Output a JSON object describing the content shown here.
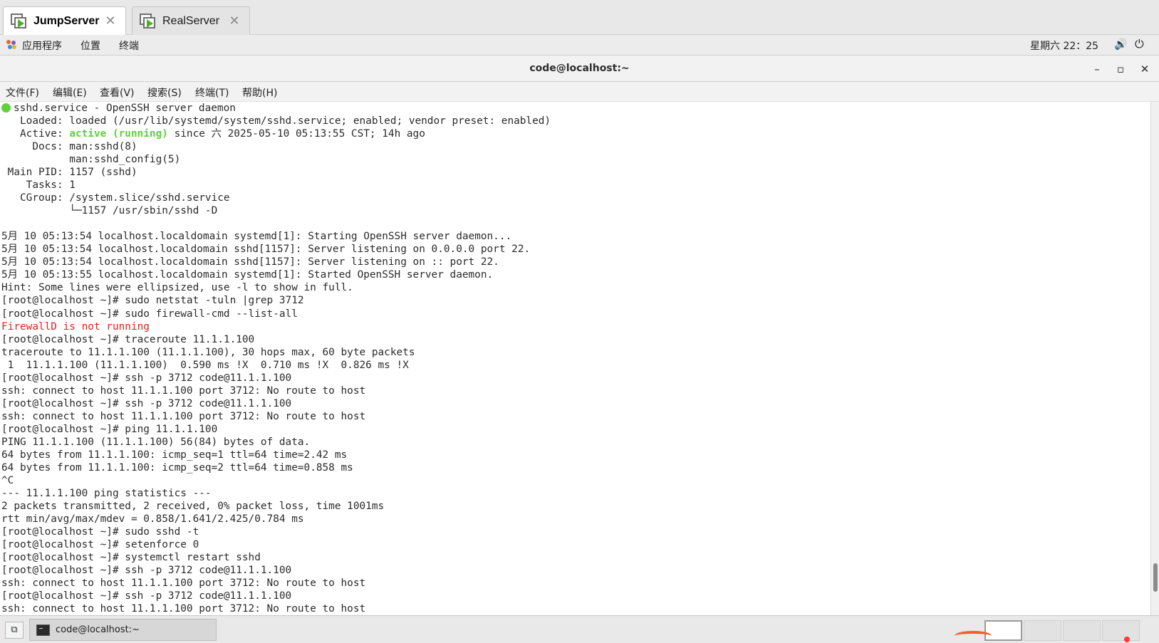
{
  "tabs": [
    {
      "label": "JumpServer",
      "active": true,
      "close": "✕"
    },
    {
      "label": "RealServer",
      "active": false,
      "close": "✕"
    }
  ],
  "panel": {
    "menus": [
      "应用程序",
      "位置",
      "终端"
    ],
    "clock": "星期六 22：25",
    "volume_icon": "🔊",
    "power_icon": "⏻"
  },
  "window": {
    "title": "code@localhost:~",
    "min": "–",
    "max": "▫",
    "close": "✕"
  },
  "menubar": [
    "文件(F)",
    "编辑(E)",
    "查看(V)",
    "搜索(S)",
    "终端(T)",
    "帮助(H)"
  ],
  "terminal": {
    "lines": [
      {
        "t": "sshd.service - OpenSSH server daemon",
        "dot": true
      },
      {
        "t": "   Loaded: loaded (/usr/lib/systemd/system/sshd.service; enabled; vendor preset: enabled)"
      },
      {
        "t": "   Active: ",
        "g": "active (running)",
        "a": " since 六 2025-05-10 05:13:55 CST; 14h ago"
      },
      {
        "t": "     Docs: man:sshd(8)"
      },
      {
        "t": "           man:sshd_config(5)"
      },
      {
        "t": " Main PID: 1157 (sshd)"
      },
      {
        "t": "    Tasks: 1"
      },
      {
        "t": "   CGroup: /system.slice/sshd.service"
      },
      {
        "t": "           └─1157 /usr/sbin/sshd -D"
      },
      {
        "t": ""
      },
      {
        "t": "5月 10 05:13:54 localhost.localdomain systemd[1]: Starting OpenSSH server daemon..."
      },
      {
        "t": "5月 10 05:13:54 localhost.localdomain sshd[1157]: Server listening on 0.0.0.0 port 22."
      },
      {
        "t": "5月 10 05:13:54 localhost.localdomain sshd[1157]: Server listening on :: port 22."
      },
      {
        "t": "5月 10 05:13:55 localhost.localdomain systemd[1]: Started OpenSSH server daemon."
      },
      {
        "t": "Hint: Some lines were ellipsized, use -l to show in full."
      },
      {
        "t": "[root@localhost ~]# sudo netstat -tuln |grep 3712"
      },
      {
        "t": "[root@localhost ~]# sudo firewall-cmd --list-all"
      },
      {
        "t": "FirewallD is not running",
        "red": true
      },
      {
        "t": "[root@localhost ~]# traceroute 11.1.1.100"
      },
      {
        "t": "traceroute to 11.1.1.100 (11.1.1.100), 30 hops max, 60 byte packets"
      },
      {
        "t": " 1  11.1.1.100 (11.1.1.100)  0.590 ms !X  0.710 ms !X  0.826 ms !X"
      },
      {
        "t": "[root@localhost ~]# ssh -p 3712 code@11.1.1.100"
      },
      {
        "t": "ssh: connect to host 11.1.1.100 port 3712: No route to host"
      },
      {
        "t": "[root@localhost ~]# ssh -p 3712 code@11.1.1.100"
      },
      {
        "t": "ssh: connect to host 11.1.1.100 port 3712: No route to host"
      },
      {
        "t": "[root@localhost ~]# ping 11.1.1.100"
      },
      {
        "t": "PING 11.1.1.100 (11.1.1.100) 56(84) bytes of data."
      },
      {
        "t": "64 bytes from 11.1.1.100: icmp_seq=1 ttl=64 time=2.42 ms"
      },
      {
        "t": "64 bytes from 11.1.1.100: icmp_seq=2 ttl=64 time=0.858 ms"
      },
      {
        "t": "^C"
      },
      {
        "t": "--- 11.1.1.100 ping statistics ---"
      },
      {
        "t": "2 packets transmitted, 2 received, 0% packet loss, time 1001ms"
      },
      {
        "t": "rtt min/avg/max/mdev = 0.858/1.641/2.425/0.784 ms"
      },
      {
        "t": "[root@localhost ~]# sudo sshd -t"
      },
      {
        "t": "[root@localhost ~]# setenforce 0"
      },
      {
        "t": "[root@localhost ~]# systemctl restart sshd"
      },
      {
        "t": "[root@localhost ~]# ssh -p 3712 code@11.1.1.100"
      },
      {
        "t": "ssh: connect to host 11.1.1.100 port 3712: No route to host"
      },
      {
        "t": "[root@localhost ~]# ssh -p 3712 code@11.1.1.100"
      },
      {
        "t": "ssh: connect to host 11.1.1.100 port 3712: No route to host"
      }
    ]
  },
  "taskbar": {
    "show_desktop_icon": "⧉",
    "task_label": "code@localhost:~",
    "workspace_count": 4,
    "current_workspace": 1
  },
  "colors": {
    "active_green": "#5fd13a",
    "error_red": "#e02020",
    "tab_play_green": "#4caf2a"
  }
}
